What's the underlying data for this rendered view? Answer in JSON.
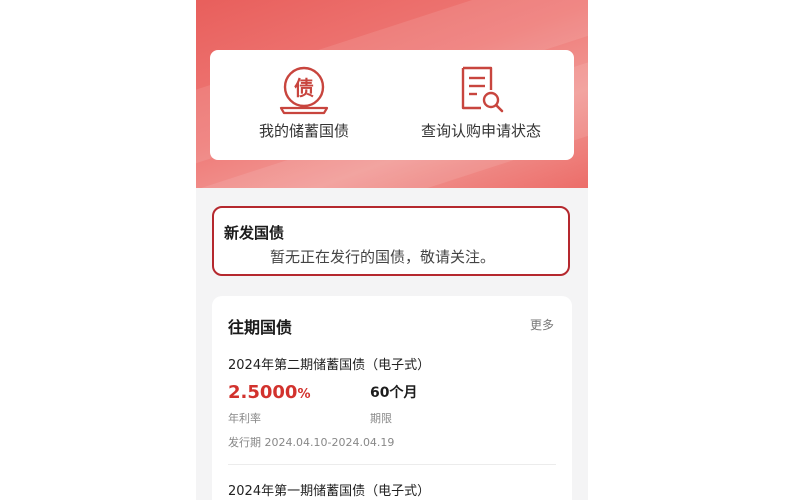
{
  "quick_actions": {
    "my_bonds": {
      "label": "我的储蓄国债",
      "icon": "bond-seal-icon",
      "icon_glyph": "债"
    },
    "query_status": {
      "label": "查询认购申请状态",
      "icon": "document-search-icon"
    }
  },
  "new_bonds": {
    "title": "新发国债",
    "message": "暂无正在发行的国债，敬请关注。"
  },
  "past_bonds": {
    "title": "往期国债",
    "more_label": "更多",
    "items": [
      {
        "name": "2024年第二期储蓄国债（电子式）",
        "rate_value": "2.5000",
        "rate_unit": "%",
        "rate_label": "年利率",
        "term_value": "60个月",
        "term_label": "期限",
        "period": "发行期 2024.04.10-2024.04.19"
      },
      {
        "name": "2024年第一期储蓄国债（电子式）"
      }
    ]
  },
  "colors": {
    "banner_red": "#e85f5c",
    "accent_red": "#d2322d",
    "border_red": "#b5282e",
    "icon_red": "#c8453e"
  }
}
